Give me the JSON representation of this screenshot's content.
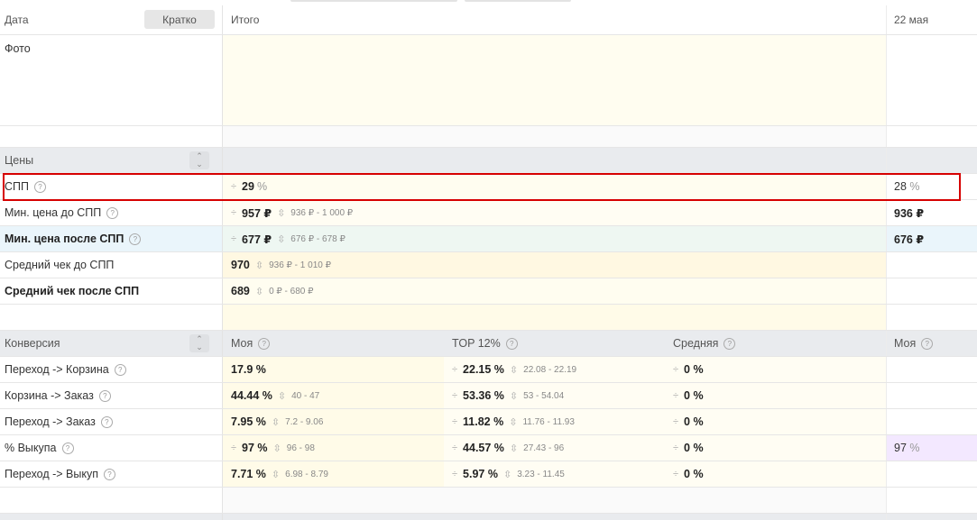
{
  "header": {
    "date_label": "Дата",
    "brief_button": "Кратко",
    "total_label": "Итого",
    "day_label": "22 мая"
  },
  "photo": {
    "label": "Фото"
  },
  "prices": {
    "section_label": "Цены",
    "rows": [
      {
        "label": "СПП",
        "total_value": "29",
        "total_unit": "%",
        "total_range": "",
        "day_value": "28",
        "day_unit": "%"
      },
      {
        "label": "Мин. цена до СПП",
        "total_value": "957 ₽",
        "total_range": "936 ₽ - 1 000 ₽",
        "day_value": "936 ₽"
      },
      {
        "label": "Мин. цена после СПП",
        "total_value": "677 ₽",
        "total_range": "676 ₽ - 678 ₽",
        "day_value": "676 ₽"
      },
      {
        "label": "Средний чек до СПП",
        "total_value": "970",
        "total_range": "936 ₽ - 1 010 ₽",
        "day_value": ""
      },
      {
        "label": "Средний чек после СПП",
        "total_value": "689",
        "total_range": "0 ₽ - 680 ₽",
        "day_value": ""
      }
    ]
  },
  "conversion": {
    "section_label": "Конверсия",
    "col_mine": "Моя",
    "col_top": "TOP 12%",
    "col_avg": "Средняя",
    "col_day_mine": "Моя",
    "rows": [
      {
        "label": "Переход -> Корзина",
        "mine": "17.9 %",
        "mine_range": "",
        "top": "22.15 %",
        "top_range": "22.08 - 22.19",
        "avg": "0 %",
        "day": ""
      },
      {
        "label": "Корзина -> Заказ",
        "mine": "44.44 %",
        "mine_range": "40 - 47",
        "top": "53.36 %",
        "top_range": "53 - 54.04",
        "avg": "0 %",
        "day": ""
      },
      {
        "label": "Переход -> Заказ",
        "mine": "7.95 %",
        "mine_range": "7.2 - 9.06",
        "top": "11.82 %",
        "top_range": "11.76 - 11.93",
        "avg": "0 %",
        "day": ""
      },
      {
        "label": "% Выкупа",
        "mine": "97 %",
        "mine_range": "96 - 98",
        "top": "44.57 %",
        "top_range": "27.43 - 96",
        "avg": "0 %",
        "day_value": "97",
        "day_unit": "%"
      },
      {
        "label": "Переход -> Выкуп",
        "mine": "7.71 %",
        "mine_range": "6.98 - 8.79",
        "top": "5.97 %",
        "top_range": "3.23 - 11.45",
        "avg": "0 %",
        "day": ""
      }
    ]
  },
  "icons": {
    "help": "help-circle-icon",
    "compare": "compare-icon",
    "range": "range-icon",
    "chevron": "chevron-updown-icon"
  },
  "colors": {
    "highlight_border": "#d60000",
    "section_bg": "#e9ebee",
    "total_bg": "#fffdf0",
    "blue_row": "#eaf5fb",
    "purple_cell": "#f3e8ff"
  }
}
